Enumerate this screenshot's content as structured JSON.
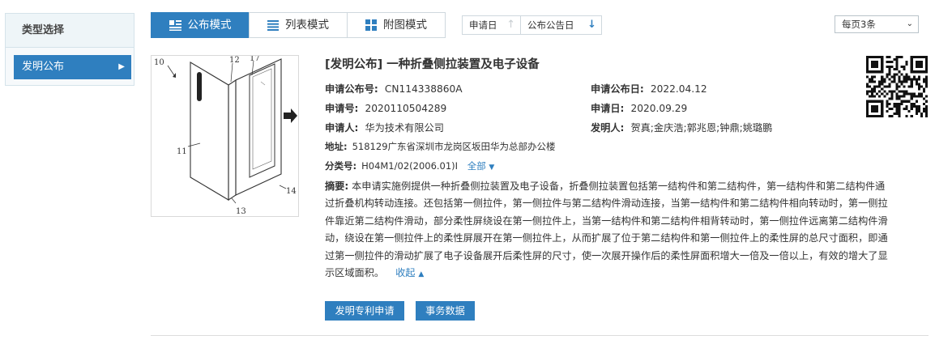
{
  "sidebar": {
    "title": "类型选择",
    "items": [
      {
        "label": "发明公布"
      }
    ]
  },
  "toolbar": {
    "modes": [
      {
        "label": "公布模式",
        "icon": "list-detail-icon",
        "active": true
      },
      {
        "label": "列表模式",
        "icon": "list-lines-icon",
        "active": false
      },
      {
        "label": "附图模式",
        "icon": "grid-icon",
        "active": false
      }
    ],
    "sort": [
      {
        "label": "申请日",
        "arrow": "↑",
        "active": false
      },
      {
        "label": "公布公告日",
        "arrow": "↓",
        "active": true
      }
    ],
    "per_page": "每页3条"
  },
  "patent": {
    "title": "[发明公布] 一种折叠侧拉装置及电子设备",
    "pub_no_label": "申请公布号:",
    "pub_no": "CN114338860A",
    "pub_date_label": "申请公布日:",
    "pub_date": "2022.04.12",
    "app_no_label": "申请号:",
    "app_no": "2020110504289",
    "app_date_label": "申请日:",
    "app_date": "2020.09.29",
    "applicant_label": "申请人:",
    "applicant": "华为技术有限公司",
    "inventor_label": "发明人:",
    "inventor": "贺真;金庆浩;郭兆恩;钟鼎;姚璐鹏",
    "address_label": "地址:",
    "address": "518129广东省深圳市龙岗区坂田华为总部办公楼",
    "class_label": "分类号:",
    "class_no": "H04M1/02(2006.01)I",
    "class_all": "全部",
    "abstract_label": "摘要:",
    "abstract_lines": [
      "本申请实施例提供一种折叠侧拉装置及电子设备，折叠侧拉装置包括第一结构件和第二结构件，第一结构件和第二结构件通",
      "过折叠机构转动连接。还包括第一侧拉件，第一侧拉件与第二结构件滑动连接，当第一结构件和第二结构件相向转动时，第一侧拉",
      "件靠近第二结构件滑动，部分柔性屏绕设在第一侧拉件上，当第一结构件和第二结构件相背转动时，第一侧拉件远离第二结构件滑",
      "动，绕设在第一侧拉件上的柔性屏展开在第一侧拉件上，从而扩展了位于第二结构件和第一侧拉件上的柔性屏的总尺寸面积，即通",
      "过第一侧拉件的滑动扩展了电子设备展开后柔性屏的尺寸，使一次展开操作后的柔性屏面积增大一倍及一倍以上，有效的增大了显",
      "示区域面积。"
    ],
    "collapse": "收起",
    "buttons": [
      "发明专利申请",
      "事务数据"
    ],
    "drawing_labels": [
      "10",
      "12",
      "17",
      "11",
      "13",
      "14"
    ]
  },
  "colors": {
    "accent": "#2f7fbf"
  }
}
